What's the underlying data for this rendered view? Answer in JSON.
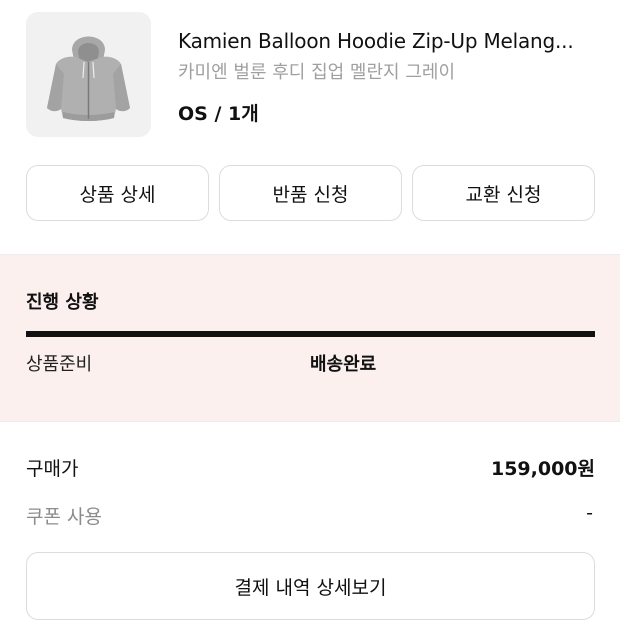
{
  "product": {
    "name": "Kamien Balloon Hoodie Zip-Up Melang...",
    "subtitle": "카미엔 벌룬 후디 집업 멜란지 그레이",
    "option": "OS / 1개",
    "image_icon": "hoodie-image"
  },
  "actions": {
    "detail": "상품 상세",
    "return": "반품 신청",
    "exchange": "교환 신청"
  },
  "status": {
    "title": "진행 상황",
    "left_step": "상품준비",
    "current_step": "배송완료",
    "progress": 1.0,
    "bar_color": "#111111",
    "background_color": "#fcf0ef"
  },
  "payment": {
    "price_label": "구매가",
    "price_value": "159,000원",
    "coupon_label": "쿠폰 사용",
    "coupon_value": "-",
    "detail_button": "결제 내역 상세보기"
  }
}
